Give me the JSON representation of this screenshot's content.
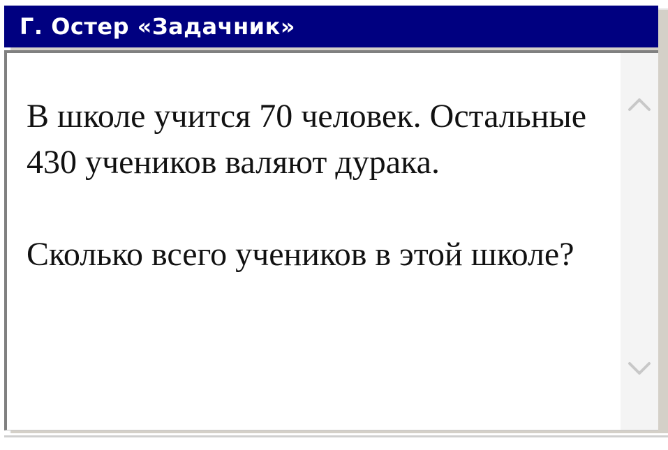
{
  "window": {
    "title": "Г. Остер «Задачник»"
  },
  "content": {
    "paragraph1": "В школе учится 70 человек. Остальные 430 учеников валяют дурака.",
    "paragraph2": "Сколько всего учеников в этой школе?"
  },
  "scrollbar": {
    "up_icon": "chevron-up-icon",
    "down_icon": "chevron-down-icon"
  },
  "colors": {
    "title_bar": "#000080",
    "title_text": "#ffffff",
    "panel": "#ffffff",
    "frame": "#d4d0c8"
  }
}
